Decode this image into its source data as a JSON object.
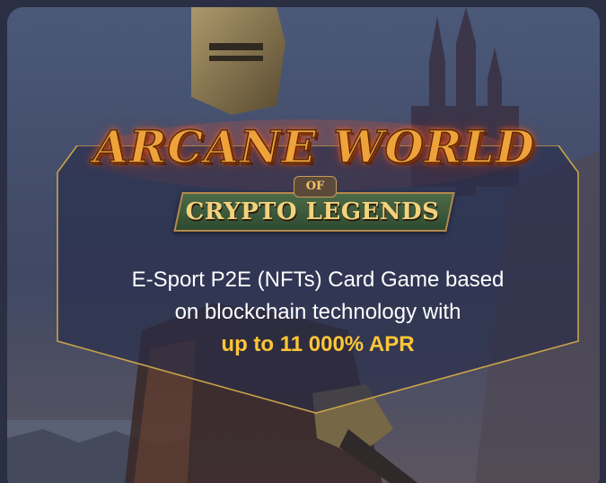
{
  "logo": {
    "title": "ARCANE WORLD",
    "of": "OF",
    "subtitle": "CRYPTO LEGENDS"
  },
  "description": {
    "line1": "E-Sport P2E (NFTs) Card Game based",
    "line2": "on blockchain technology with",
    "highlight": "up to 11 000% APR"
  },
  "colors": {
    "accent": "#ffc637",
    "panel_border": "#c9a24a",
    "background": "#3c4561"
  }
}
